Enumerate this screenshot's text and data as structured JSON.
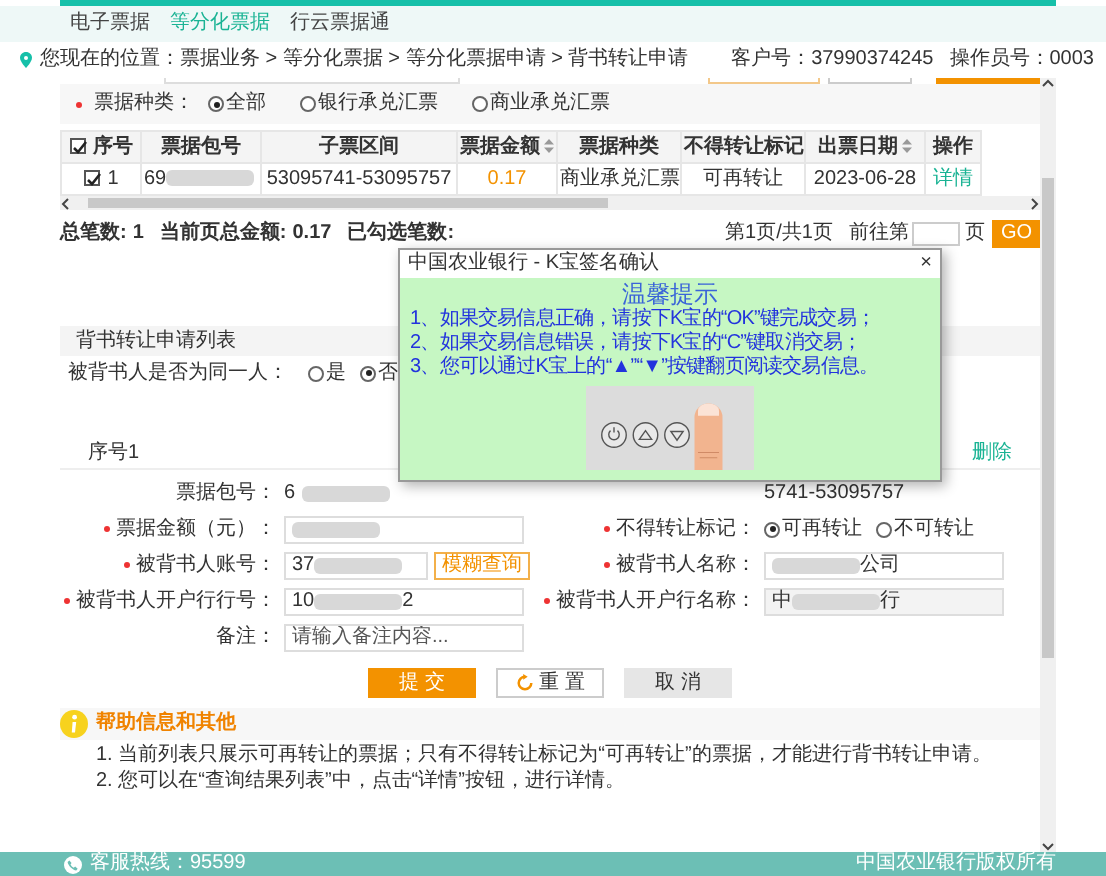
{
  "top_nav": {
    "tabs": [
      {
        "label": "电子票据",
        "selected": false
      },
      {
        "label": "等分化票据",
        "selected": true
      },
      {
        "label": "行云票据通",
        "selected": false
      }
    ]
  },
  "breadcrumb": "您现在的位置：票据业务 > 等分化票据 > 等分化票据申请 > 背书转让申请",
  "account": {
    "customer_no": "客户号：37990374245",
    "operator_no": "操作员号：0003"
  },
  "filter": {
    "label": "票据种类：",
    "required": true,
    "options": [
      {
        "label": "全部",
        "selected": true
      },
      {
        "label": "银行承兑汇票",
        "selected": false
      },
      {
        "label": "商业承兑汇票",
        "selected": false
      }
    ]
  },
  "table": {
    "header_checked": true,
    "columns": [
      {
        "label": "序号",
        "kind": "index",
        "sortable": false
      },
      {
        "label": "票据包号",
        "kind": "redacted",
        "sortable": false
      },
      {
        "label": "子票区间",
        "kind": "text",
        "sortable": false
      },
      {
        "label": "票据金额",
        "kind": "amount",
        "sortable": true
      },
      {
        "label": "票据种类",
        "kind": "text",
        "sortable": false
      },
      {
        "label": "不得转让标记",
        "kind": "text",
        "sortable": false
      },
      {
        "label": "出票日期",
        "kind": "text",
        "sortable": true
      },
      {
        "label": "操作",
        "kind": "link",
        "sortable": false
      }
    ],
    "rows": [
      {
        "checked": true,
        "cells": [
          "1",
          "69",
          "53095741-53095757",
          "0.17",
          "商业承兑汇票",
          "可再转让",
          "2023-06-28",
          "详情"
        ]
      }
    ]
  },
  "summary": [
    {
      "label": "总笔数:",
      "value": "1"
    },
    {
      "label": "当前页总金额:",
      "value": "0.17"
    },
    {
      "label": "已勾选笔数:"
    }
  ],
  "pagination": {
    "page_info": "第1页/共1页",
    "goto_label": "前往第",
    "page_suffix": "页",
    "go": "GO"
  },
  "dialog": {
    "title": "中国农业银行 - K宝签名确认",
    "close": "×",
    "heading": "温馨提示",
    "lines": [
      "1、如果交易信息正确，请按下K宝的“OK”键完成交易；",
      "2、如果交易信息错误，请按下K宝的“C”键取消交易；",
      "3、您可以通过K宝上的“▲”“▼”按键翻页阅读交易信息。"
    ]
  },
  "application": {
    "title": "背书转让申请列表",
    "same_person": {
      "label": "被背书人是否为同一人：",
      "options": [
        {
          "label": "是",
          "selected": false
        },
        {
          "label": "否",
          "selected": true
        }
      ]
    },
    "entry_title": "序号1",
    "delete": "删除",
    "fields": [
      {
        "label": "票据包号：",
        "required": false,
        "kind": "static",
        "value_start": "6",
        "blurred": true
      },
      {
        "kind": "static",
        "required": false,
        "value_start": "5741-53095757",
        "blurred": false
      },
      {
        "label": "票据金额（元）：",
        "required": true,
        "kind": "input",
        "blurred": true,
        "readonly": false
      },
      {
        "label": "不得转让标记：",
        "required": true,
        "kind": "radio",
        "options": [
          {
            "label": "可再转让",
            "selected": true
          },
          {
            "label": "不可转让",
            "selected": false
          }
        ]
      },
      {
        "label": "被背书人账号：",
        "required": true,
        "kind": "input",
        "value_start": "37",
        "blurred": true,
        "readonly": false,
        "button": "模糊查询"
      },
      {
        "label": "被背书人名称：",
        "required": true,
        "kind": "input",
        "blurred": true,
        "value_end": "公司",
        "readonly": false
      },
      {
        "label": "被背书人开户行行号：",
        "required": true,
        "kind": "input",
        "value_start": "10",
        "blurred": true,
        "value_end": "2",
        "readonly": false
      },
      {
        "label": "被背书人开户行名称：",
        "required": true,
        "kind": "input",
        "value_start": "中",
        "blurred": true,
        "value_end": "行",
        "readonly": true
      },
      {
        "label": "备注：",
        "required": false,
        "kind": "input",
        "placeholder": "请输入备注内容...",
        "readonly": false
      }
    ]
  },
  "buttons": [
    {
      "label": "提 交",
      "kind": "primary"
    },
    {
      "label": "重 置",
      "kind": "reset"
    },
    {
      "label": "取 消",
      "kind": "cancel"
    }
  ],
  "help": {
    "title": "帮助信息和其他",
    "items": [
      "1. 当前列表只展示可再转让的票据；只有不得转让标记为“可再转让”的票据，才能进行背书转让申请。",
      "2. 您可以在“查询结果列表”中，点击“详情”按钮，进行详情。"
    ]
  },
  "footer": {
    "hotline": "客服热线：95599",
    "copyright": "中国农业银行版权所有"
  }
}
